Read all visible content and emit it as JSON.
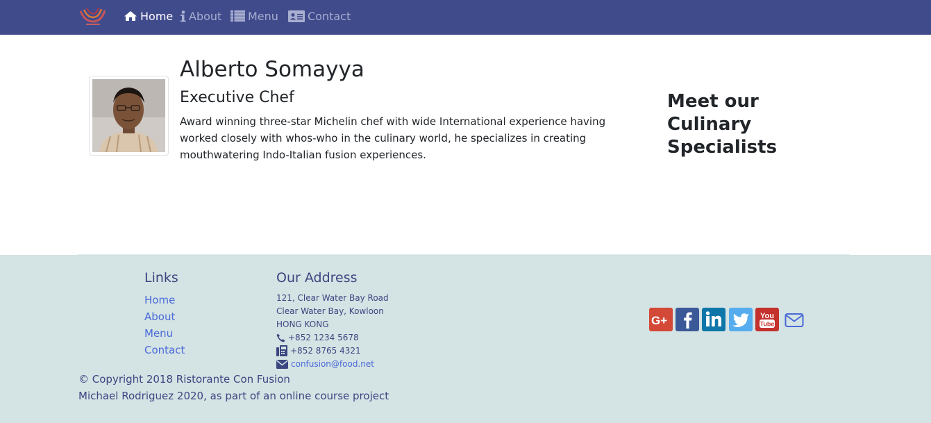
{
  "navbar": {
    "brand_icon": "restaurant-logo-icon",
    "items": [
      {
        "label": "Home",
        "icon": "home-icon",
        "active": true
      },
      {
        "label": "About",
        "icon": "info-icon",
        "active": false
      },
      {
        "label": "Menu",
        "icon": "list-icon",
        "active": false
      },
      {
        "label": "Contact",
        "icon": "address-card-icon",
        "active": false
      }
    ],
    "colors": {
      "background": "#404b8c",
      "active": "#ffffff",
      "inactive": "#a8aed0"
    }
  },
  "leader": {
    "name": "Alberto Somayya",
    "designation": "Executive Chef",
    "description": "Award winning three-star Michelin chef with wide International experience having worked closely with whos-who in the culinary world, he specializes in creating mouthwatering Indo-Italian fusion experiences."
  },
  "sidebar": {
    "heading": "Meet our Culinary Specialists"
  },
  "footer": {
    "links_heading": "Links",
    "links": [
      "Home",
      "About",
      "Menu",
      "Contact"
    ],
    "address_heading": "Our Address",
    "address_lines": [
      "121, Clear Water Bay Road",
      "Clear Water Bay, Kowloon",
      "HONG KONG"
    ],
    "phone": "+852 1234 5678",
    "fax": "+852 8765 4321",
    "email": "confusion@food.net",
    "social": [
      "google-plus-icon",
      "facebook-icon",
      "linkedin-icon",
      "twitter-icon",
      "youtube-icon",
      "envelope-icon"
    ],
    "copyright": "© Copyright 2018 Ristorante Con Fusion",
    "credit": "Michael Rodriguez 2020, as part of an online course project",
    "colors": {
      "background": "#d4e3e4",
      "heading": "#3c4680",
      "link": "#4a6ad8"
    }
  }
}
